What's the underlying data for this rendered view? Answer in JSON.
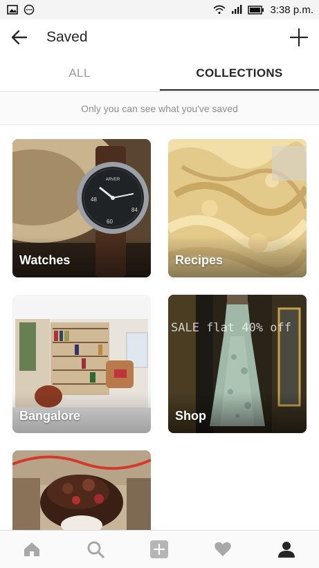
{
  "status_bar": {
    "time": "3:38 p.m.",
    "left_icons": [
      "image-icon",
      "messenger-icon"
    ],
    "right_icons": [
      "wifi-icon",
      "signal-icon",
      "battery-icon"
    ]
  },
  "header": {
    "title": "Saved",
    "back_icon": "back-arrow-icon",
    "add_icon": "plus-icon"
  },
  "tabs": [
    {
      "label": "ALL",
      "active": false
    },
    {
      "label": "COLLECTIONS",
      "active": true
    }
  ],
  "notice": "Only you can see what you've saved",
  "collections": [
    {
      "label": "Watches"
    },
    {
      "label": "Recipes"
    },
    {
      "label": "Bangalore"
    },
    {
      "label": "Shop"
    },
    {
      "label": ""
    }
  ],
  "shop_overlay_text": "SALE flat 40% off",
  "bottom_nav": [
    {
      "icon": "home-icon"
    },
    {
      "icon": "search-icon"
    },
    {
      "icon": "add-post-icon"
    },
    {
      "icon": "heart-icon"
    },
    {
      "icon": "profile-icon",
      "active": true
    }
  ],
  "colors": {
    "text": "#262626",
    "muted": "#8e8e8e",
    "inactive_icon": "#a8a8a8"
  }
}
